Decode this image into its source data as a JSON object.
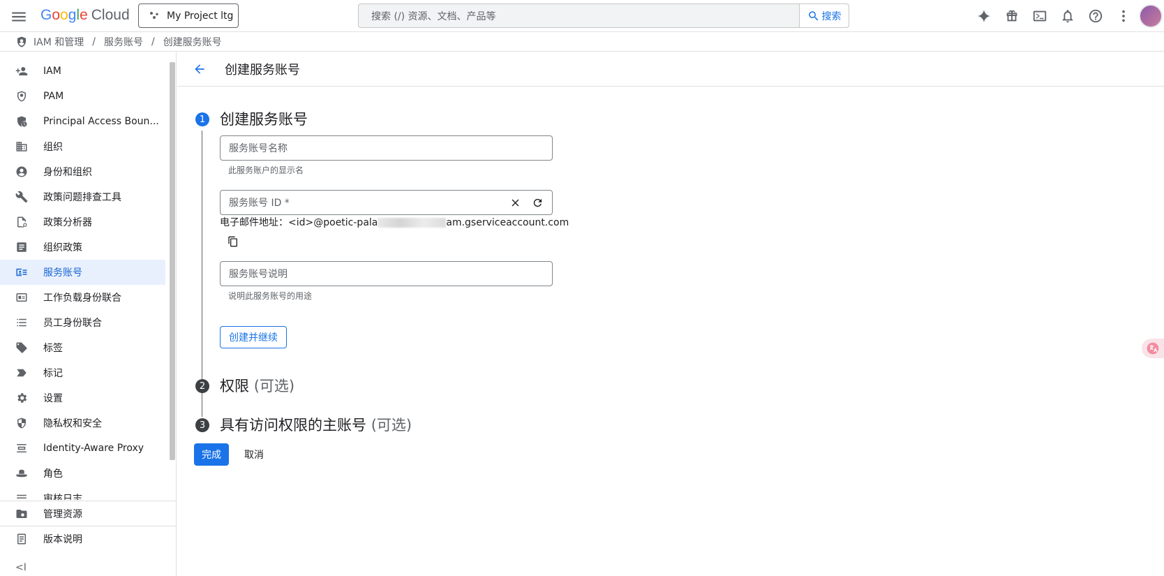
{
  "colors": {
    "accent": "#1a73e8",
    "active_bg": "#e8f0fe",
    "step_active": "#1a73e8",
    "step_inactive": "#3c4043"
  },
  "header": {
    "logo_letters": [
      "G",
      "o",
      "o",
      "g",
      "l",
      "e"
    ],
    "logo_suffix": "Cloud",
    "project_name": "My Project ltg",
    "search_placeholder": "搜索 (/) 资源、文档、产品等",
    "search_button": "搜索",
    "icons": [
      "gemini-icon",
      "gift-icon",
      "terminal-icon",
      "bell-icon",
      "help-icon",
      "more-vert-icon"
    ]
  },
  "breadcrumb": {
    "items": [
      "IAM 和管理",
      "服务账号",
      "创建服务账号"
    ]
  },
  "sidebar": {
    "items": [
      {
        "label": "IAM",
        "icon": "person-add-icon"
      },
      {
        "label": "PAM",
        "icon": "shield-icon"
      },
      {
        "label": "Principal Access Boun...",
        "icon": "shield-clock-icon"
      },
      {
        "label": "组织",
        "icon": "building-icon"
      },
      {
        "label": "身份和组织",
        "icon": "account-circle-icon"
      },
      {
        "label": "政策问题排查工具",
        "icon": "wrench-icon"
      },
      {
        "label": "政策分析器",
        "icon": "doc-search-icon"
      },
      {
        "label": "组织政策",
        "icon": "article-icon"
      },
      {
        "label": "服务账号",
        "icon": "service-account-icon",
        "active": true
      },
      {
        "label": "工作负载身份联合",
        "icon": "id-card-icon"
      },
      {
        "label": "员工身份联合",
        "icon": "list-icon"
      },
      {
        "label": "标签",
        "icon": "tag-icon"
      },
      {
        "label": "标记",
        "icon": "label-icon"
      },
      {
        "label": "设置",
        "icon": "gear-icon"
      },
      {
        "label": "隐私权和安全",
        "icon": "security-icon"
      },
      {
        "label": "Identity-Aware Proxy",
        "icon": "proxy-icon"
      },
      {
        "label": "角色",
        "icon": "hat-icon"
      },
      {
        "label": "审核日志",
        "icon": "lines-icon"
      }
    ],
    "bottom": [
      {
        "label": "管理资源",
        "icon": "folder-gear-icon"
      },
      {
        "label": "版本说明",
        "icon": "notes-icon"
      }
    ],
    "collapse_glyph": "<I"
  },
  "page": {
    "title": "创建服务账号",
    "step1": {
      "number": "1",
      "title": "创建服务账号",
      "name_placeholder": "服务账号名称",
      "name_hint": "此服务账户的显示名",
      "id_placeholder": "服务账号 ID *",
      "email_prefix": "电子邮件地址：<id>@poetic-pala",
      "email_suffix": "am.gserviceaccount.com",
      "desc_placeholder": "服务账号说明",
      "desc_hint": "说明此服务账号的用途",
      "continue_button": "创建并继续"
    },
    "step2": {
      "number": "2",
      "title": "权限",
      "optional": "(可选)"
    },
    "step3": {
      "number": "3",
      "title": "具有访问权限的主账号",
      "optional": "(可选)"
    },
    "done_button": "完成",
    "cancel_button": "取消"
  }
}
